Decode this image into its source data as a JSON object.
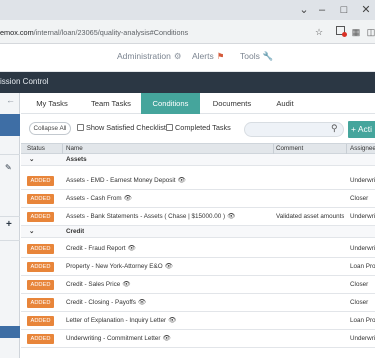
{
  "browser": {
    "url_host": "emox.com",
    "url_path": "/internal/loan/23065/quality-analysis#Conditions",
    "icons": [
      "star-icon",
      "extension-icon",
      "puzzle-icon",
      "window-icon",
      "menu-icon"
    ]
  },
  "nav": {
    "administration": "Administration",
    "alerts": "Alerts",
    "tools": "Tools"
  },
  "titlebar": {
    "text": "ission Control"
  },
  "tabs": [
    {
      "label": "My Tasks"
    },
    {
      "label": "Team Tasks"
    },
    {
      "label": "Conditions"
    },
    {
      "label": "Documents"
    },
    {
      "label": "Audit"
    }
  ],
  "toolbar": {
    "collapse_label": "Collapse All",
    "show_satisfied": "Show Satisfied Checklists",
    "completed_tasks": "Completed Tasks",
    "search_value": "",
    "add_label": "+ Acti"
  },
  "table": {
    "headers": {
      "status": "Status",
      "name": "Name",
      "comment": "Comment",
      "assignee": "Assignee"
    },
    "assets_group": "Assets",
    "credit_group": "Credit",
    "assets_rows": [
      {
        "status": "ADDED",
        "name": "Assets - EMD - Earnest Money Deposit",
        "comment": "",
        "assignee": "Underwriti"
      },
      {
        "status": "ADDED",
        "name": "Assets - Cash From",
        "comment": "",
        "assignee": "Closer"
      },
      {
        "status": "ADDED",
        "name": "Assets - Bank Statements - Assets ( Chase | $15000.00 )",
        "comment": "Validated asset amounts.",
        "assignee": "Underwriti"
      }
    ],
    "credit_rows": [
      {
        "status": "ADDED",
        "name": "Credit - Fraud Report",
        "comment": "",
        "assignee": "Underwriti"
      },
      {
        "status": "ADDED",
        "name": "Property - New York-Attorney E&O",
        "comment": "",
        "assignee": "Loan Proc"
      },
      {
        "status": "ADDED",
        "name": "Credit - Sales Price",
        "comment": "",
        "assignee": "Closer"
      },
      {
        "status": "ADDED",
        "name": "Credit - Closing - Payoffs",
        "comment": "",
        "assignee": "Closer"
      },
      {
        "status": "ADDED",
        "name": "Letter of Explanation - Inquiry Letter",
        "comment": "",
        "assignee": "Loan Proc"
      },
      {
        "status": "ADDED",
        "name": "Underwriting - Commitment Letter",
        "comment": "",
        "assignee": "Underwriti"
      }
    ]
  },
  "colors": {
    "teal": "#45a59c",
    "dark_bar": "#2b3744",
    "badge_orange": "#e8853a",
    "side_blue": "#3e6ea5"
  }
}
